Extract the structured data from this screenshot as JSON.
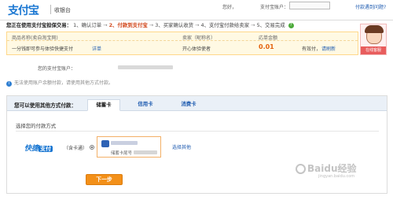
{
  "header": {
    "logo": "支付宝",
    "site_name": "收银台",
    "greeting": "您好，",
    "account_label": "支付宝账户：",
    "help_link": "付款遇到问题?"
  },
  "flow": {
    "lead": "您正在使用支付宝担保交易：",
    "steps": [
      "1、确认订单",
      "2、付款到支付宝",
      "3、买家确认收货",
      "4、支付宝付款给卖家",
      "5、交易完成"
    ],
    "active_index": 1,
    "arrow": "→",
    "help_mark": "?"
  },
  "order": {
    "col_product": "商品名称(卖自淘宝网)",
    "col_seller": "卖家（昵称名）",
    "col_amount": "応单金额",
    "product_text": "一分钱即可参与体验快捷支付",
    "detail_link": "详单",
    "seller_text": "开心体验使者",
    "amount": "0.01",
    "amount_suffix": "有效付，",
    "refresh_link": "请刷新"
  },
  "avatar": {
    "caption": "在线客服"
  },
  "account_line": "您的支付宝账户：",
  "notice": {
    "icon": "i",
    "text": "无法使用账户余额付款，请使用其他方式付款。"
  },
  "methods": {
    "title": "您可以使用其他方式付款：",
    "tabs": [
      {
        "label": "储蓄卡",
        "active": true
      },
      {
        "label": "信用卡",
        "active": false
      },
      {
        "label": "消费卡",
        "active": false
      }
    ],
    "section_label": "选择您的付款方式",
    "kuaijie": "快捷",
    "kuaijie_pay": "支付",
    "kuaijie_sub": "（含卡通）",
    "card_number_prefix": "储蓄卡尾号",
    "other_link": "选择其他",
    "next_button": "下一步"
  },
  "watermark": {
    "text": "Baidu经验",
    "sub": "jingyan.baidu.com"
  },
  "colors": {
    "brand": "#1a77d2",
    "accent": "#f39019",
    "active_step": "#d24a1f",
    "link": "#1e5bb0"
  }
}
